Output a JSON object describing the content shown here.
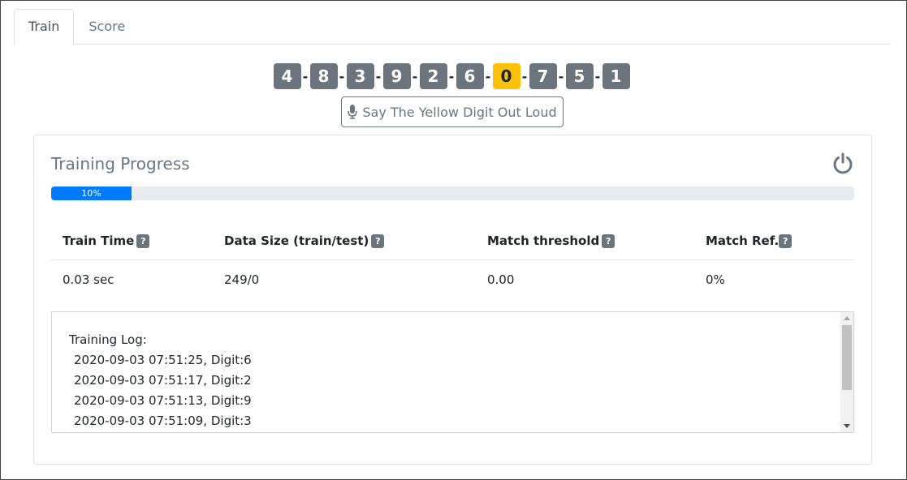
{
  "tabs": [
    {
      "label": "Train",
      "active": true
    },
    {
      "label": "Score",
      "active": false
    }
  ],
  "digits": [
    {
      "value": "4",
      "highlight": false
    },
    {
      "value": "8",
      "highlight": false
    },
    {
      "value": "3",
      "highlight": false
    },
    {
      "value": "9",
      "highlight": false
    },
    {
      "value": "2",
      "highlight": false
    },
    {
      "value": "6",
      "highlight": false
    },
    {
      "value": "0",
      "highlight": true
    },
    {
      "value": "7",
      "highlight": false
    },
    {
      "value": "5",
      "highlight": false
    },
    {
      "value": "1",
      "highlight": false
    }
  ],
  "digit_separator": "-",
  "say_button": {
    "label": "Say The Yellow Digit Out Loud",
    "icon": "microphone-icon"
  },
  "card": {
    "title": "Training Progress",
    "power_icon": "power-icon",
    "progress": {
      "percent": 10,
      "label": "10%"
    },
    "table": {
      "headers": [
        "Train Time",
        "Data Size (train/test)",
        "Match threshold",
        "Match Ref."
      ],
      "help_symbol": "?",
      "values": [
        "0.03 sec",
        "249/0",
        "0.00",
        "0%"
      ]
    },
    "log": {
      "title": "Training Log:",
      "lines": [
        "2020-09-03 07:51:25, Digit:6",
        "2020-09-03 07:51:17, Digit:2",
        "2020-09-03 07:51:13, Digit:9",
        "2020-09-03 07:51:09, Digit:3"
      ]
    }
  },
  "colors": {
    "accent": "#007bff",
    "digit_bg": "#6c757d",
    "digit_highlight": "#ffc107",
    "muted": "#6c757d"
  }
}
